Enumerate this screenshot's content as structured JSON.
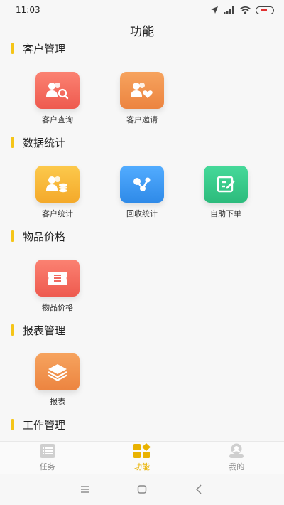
{
  "status": {
    "time": "11:03",
    "battery_color": "#e03030"
  },
  "page": {
    "title": "功能"
  },
  "colors": {
    "accent": "#f5c518",
    "tab_active": "#e9b200",
    "tab_inactive": "#888888"
  },
  "sections": [
    {
      "title": "客户管理",
      "tiles": [
        {
          "label": "客户查询",
          "icon": "customer-search-icon",
          "color": "#f46a5e"
        },
        {
          "label": "客户邀请",
          "icon": "customer-invite-icon",
          "color": "#f0904a"
        }
      ]
    },
    {
      "title": "数据统计",
      "tiles": [
        {
          "label": "客户统计",
          "icon": "customer-stats-icon",
          "color": "#f7b73a"
        },
        {
          "label": "回收统计",
          "icon": "recycle-stats-icon",
          "color": "#3b9af3"
        },
        {
          "label": "自助下单",
          "icon": "self-order-icon",
          "color": "#35c98a"
        }
      ]
    },
    {
      "title": "物品价格",
      "tiles": [
        {
          "label": "物品价格",
          "icon": "ticket-icon",
          "color": "#f46a5e"
        }
      ]
    },
    {
      "title": "报表管理",
      "tiles": [
        {
          "label": "报表",
          "icon": "layers-icon",
          "color": "#f0904a"
        }
      ]
    },
    {
      "title": "工作管理",
      "tiles": []
    }
  ],
  "tab_bar": {
    "tabs": [
      {
        "label": "任务",
        "icon": "task-list-icon",
        "active": false
      },
      {
        "label": "功能",
        "icon": "function-grid-icon",
        "active": true
      },
      {
        "label": "我的",
        "icon": "profile-icon",
        "active": false
      }
    ]
  },
  "nav_bar": {
    "buttons": [
      "menu-icon",
      "home-icon",
      "back-icon"
    ]
  }
}
